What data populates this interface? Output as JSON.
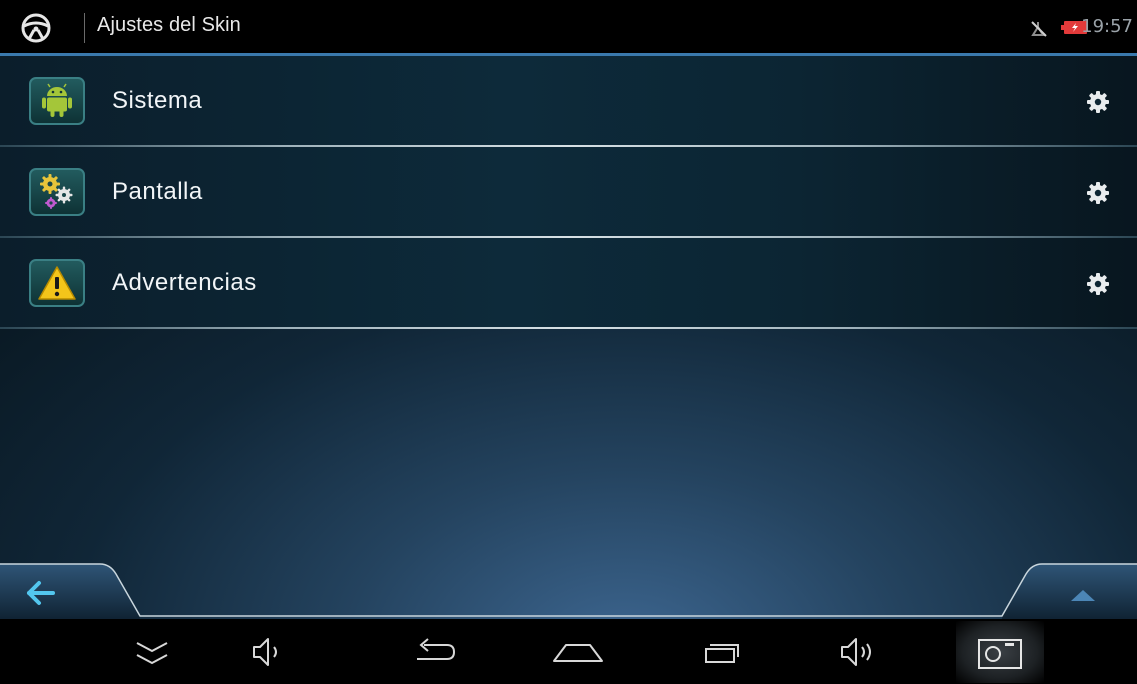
{
  "header": {
    "title": "Ajustes del Skin",
    "time": "19:57",
    "app_icon": "steering-wheel-icon",
    "gps_icon": "gps-off-icon",
    "battery_icon": "battery-charging-icon"
  },
  "menu": {
    "items": [
      {
        "label": "Sistema",
        "icon": "android-icon"
      },
      {
        "label": "Pantalla",
        "icon": "gears-icon"
      },
      {
        "label": "Advertencias",
        "icon": "warning-icon"
      }
    ],
    "settings_icon": "gear-icon"
  },
  "navigation": {
    "back_icon": "arrow-left-icon",
    "up_icon": "chevron-up-icon"
  },
  "system_bar": {
    "buttons": [
      "hide-bar-icon",
      "volume-down-icon",
      "back-icon",
      "home-icon",
      "recent-apps-icon",
      "volume-up-icon",
      "screenshot-icon"
    ]
  },
  "colors": {
    "accent": "#3a79ad",
    "icon_green": "#a4c639",
    "text": "#f2f5f7"
  }
}
